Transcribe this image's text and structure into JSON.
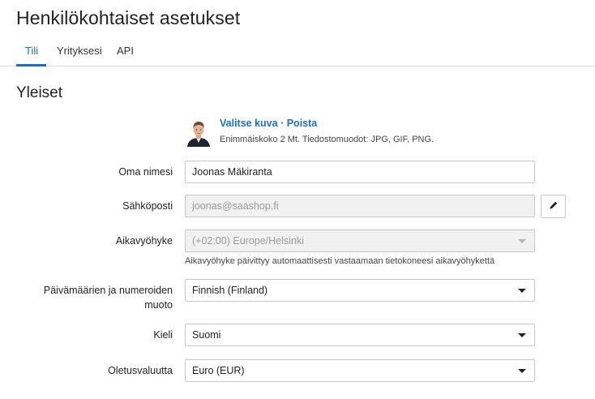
{
  "header": {
    "title": "Henkilökohtaiset asetukset"
  },
  "tabs": [
    {
      "label": "Tili",
      "active": true
    },
    {
      "label": "Yrityksesi",
      "active": false
    },
    {
      "label": "API",
      "active": false
    }
  ],
  "section": {
    "title": "Yleiset"
  },
  "photo": {
    "choose_label": "Valitse kuva",
    "separator": "·",
    "remove_label": "Poista",
    "hint": "Enimmäiskoko 2 Mt. Tiedostomuodot: JPG, GIF, PNG."
  },
  "form": {
    "name": {
      "label": "Oma nimesi",
      "value": "Joonas Mäkiranta"
    },
    "email": {
      "label": "Sähköposti",
      "placeholder": "joonas@saashop.fi"
    },
    "timezone": {
      "label": "Aikavyöhyke",
      "value": "(+02:00) Europe/Helsinki",
      "hint": "Aikavyöhyke päivittyy automaattisesti vastaamaan tietokoneesi aikavyöhykettä"
    },
    "format": {
      "label_line1": "Päivämäärien ja numeroiden",
      "label_line2": "muoto",
      "value": "Finnish (Finland)"
    },
    "language": {
      "label": "Kieli",
      "value": "Suomi"
    },
    "currency": {
      "label": "Oletusvaluutta",
      "value": "Euro (EUR)"
    }
  },
  "icons": {
    "edit": "pencil-icon",
    "dropdown": "caret-down-icon"
  },
  "colors": {
    "accent": "#1a6fc9",
    "border": "#c8c8c8",
    "disabled_bg": "#f1f1f1"
  }
}
